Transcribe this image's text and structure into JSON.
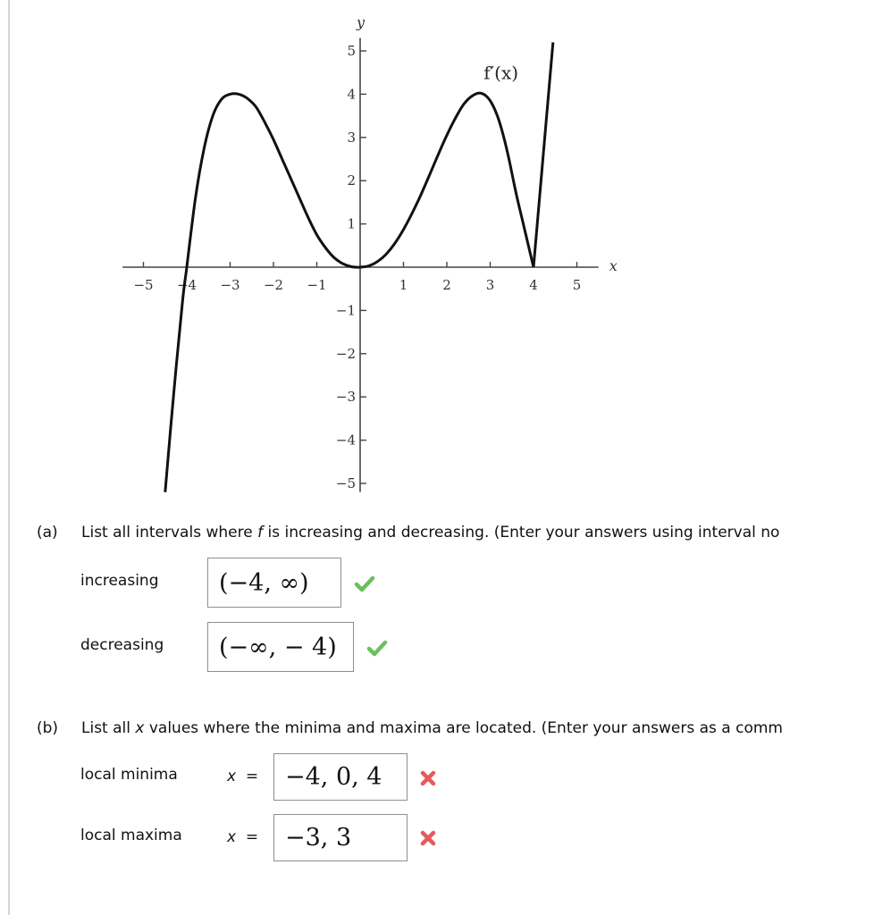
{
  "chart_data": {
    "type": "line",
    "title": "",
    "curve_label": "f′(x)",
    "xlabel": "x",
    "ylabel": "y",
    "xlim": [
      -5.4,
      5.5
    ],
    "ylim": [
      -5.2,
      5.3
    ],
    "grid": false,
    "xticks": [
      -5,
      -4,
      -3,
      -2,
      -1,
      1,
      2,
      3,
      4,
      5
    ],
    "xtick_labels": [
      "−5",
      "−4",
      "−3",
      "−2",
      "−1",
      "1",
      "2",
      "3",
      "4",
      "5"
    ],
    "yticks": [
      5,
      4,
      3,
      2,
      1,
      -1,
      -2,
      -3,
      -4,
      -5
    ],
    "ytick_labels": [
      "5",
      "4",
      "3",
      "2",
      "1",
      "−1",
      "−2",
      "−3",
      "−4",
      "−5"
    ],
    "series": [
      {
        "name": "f′(x)",
        "key_points": [
          {
            "x": -4.5,
            "y": -5.2
          },
          {
            "x": -4,
            "y": 0
          },
          {
            "x": -2.8,
            "y": 4
          },
          {
            "x": 0,
            "y": 0
          },
          {
            "x": 2.8,
            "y": 4
          },
          {
            "x": 4,
            "y": 0
          },
          {
            "x": 4.45,
            "y": 5.2
          }
        ],
        "x": [
          -4.5,
          -4.3,
          -4.1,
          -4.0,
          -3.8,
          -3.6,
          -3.4,
          -3.2,
          -3.0,
          -2.8,
          -2.6,
          -2.4,
          -2.2,
          -2.0,
          -1.8,
          -1.6,
          -1.4,
          -1.2,
          -1.0,
          -0.8,
          -0.6,
          -0.4,
          -0.2,
          0.0,
          0.2,
          0.4,
          0.6,
          0.8,
          1.0,
          1.2,
          1.4,
          1.6,
          1.8,
          2.0,
          2.2,
          2.4,
          2.6,
          2.8,
          3.0,
          3.2,
          3.4,
          3.6,
          3.8,
          4.0,
          4.1,
          4.2,
          4.3,
          4.45
        ],
        "y": [
          -5.2,
          -2.9,
          -0.8,
          0.0,
          1.6,
          2.75,
          3.5,
          3.88,
          4.0,
          4.0,
          3.9,
          3.7,
          3.35,
          2.95,
          2.5,
          2.05,
          1.6,
          1.15,
          0.75,
          0.45,
          0.22,
          0.08,
          0.01,
          0.0,
          0.03,
          0.13,
          0.3,
          0.55,
          0.87,
          1.25,
          1.67,
          2.13,
          2.6,
          3.05,
          3.45,
          3.78,
          3.97,
          4.02,
          3.85,
          3.4,
          2.65,
          1.7,
          0.85,
          0.0,
          1.15,
          2.3,
          3.45,
          5.2
        ]
      }
    ]
  },
  "part_a": {
    "label": "(a)",
    "prompt_prefix": "List all intervals where ",
    "prompt_var": "f",
    "prompt_suffix": " is increasing and decreasing. (Enter your answers using interval no",
    "rows": [
      {
        "label": "increasing",
        "value": "(−4, ∞)",
        "status": "correct"
      },
      {
        "label": "decreasing",
        "value": "(−∞, − 4)",
        "status": "correct"
      }
    ]
  },
  "part_b": {
    "label": "(b)",
    "prompt_prefix": "List all ",
    "prompt_var": "x",
    "prompt_suffix": " values where the minima and maxima are located. (Enter your answers as a comm",
    "x_prefix_var": "x",
    "x_prefix_eq": "=",
    "rows": [
      {
        "label": "local minima",
        "value": "−4, 0, 4",
        "status": "incorrect"
      },
      {
        "label": "local maxima",
        "value": "−3, 3",
        "status": "incorrect"
      }
    ]
  },
  "icons": {
    "correct": "checkmark-icon",
    "incorrect": "x-mark-icon"
  },
  "colors": {
    "correct": "#6cbf5c",
    "incorrect": "#e85a5a",
    "curve": "#111111",
    "axis": "#444444"
  }
}
